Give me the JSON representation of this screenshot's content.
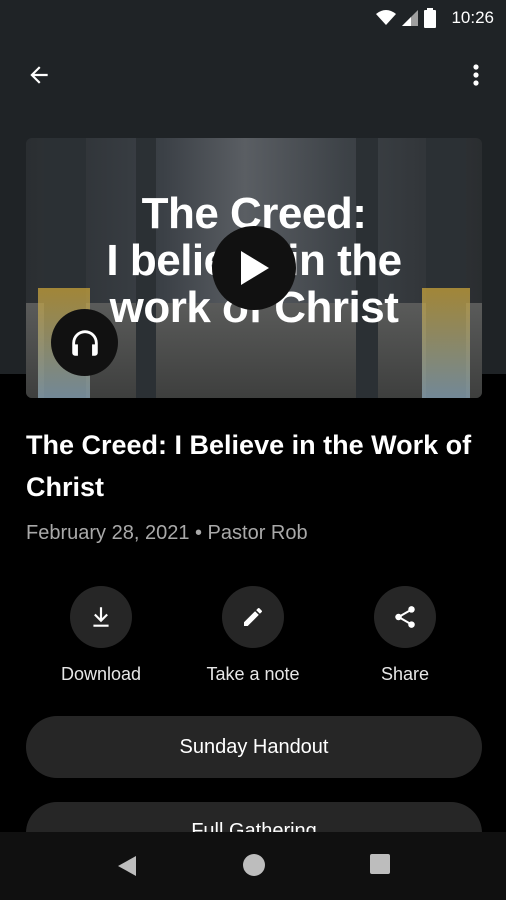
{
  "status_bar": {
    "time": "10:26",
    "icons": [
      "wifi-icon",
      "signal-icon",
      "battery-icon"
    ]
  },
  "toolbar": {
    "back_icon": "arrow-left-icon",
    "menu_icon": "more-vert-icon"
  },
  "hero": {
    "text_line1": "The Creed:",
    "text_line2": "I believe in the",
    "text_line3": "work of Christ"
  },
  "sermon": {
    "title": "The Creed: I Believe in the Work of Christ",
    "meta": "February 28, 2021 • Pastor Rob"
  },
  "actions": [
    {
      "label": "Download",
      "icon": "download-icon"
    },
    {
      "label": "Take a note",
      "icon": "pencil-icon"
    },
    {
      "label": "Share",
      "icon": "share-icon"
    }
  ],
  "resources": {
    "handout": "Sunday Handout",
    "gathering": "Full Gathering"
  },
  "colors": {
    "header_bg": "#1f2326",
    "button_bg": "#262626",
    "meta_text": "#a9a9a9"
  }
}
